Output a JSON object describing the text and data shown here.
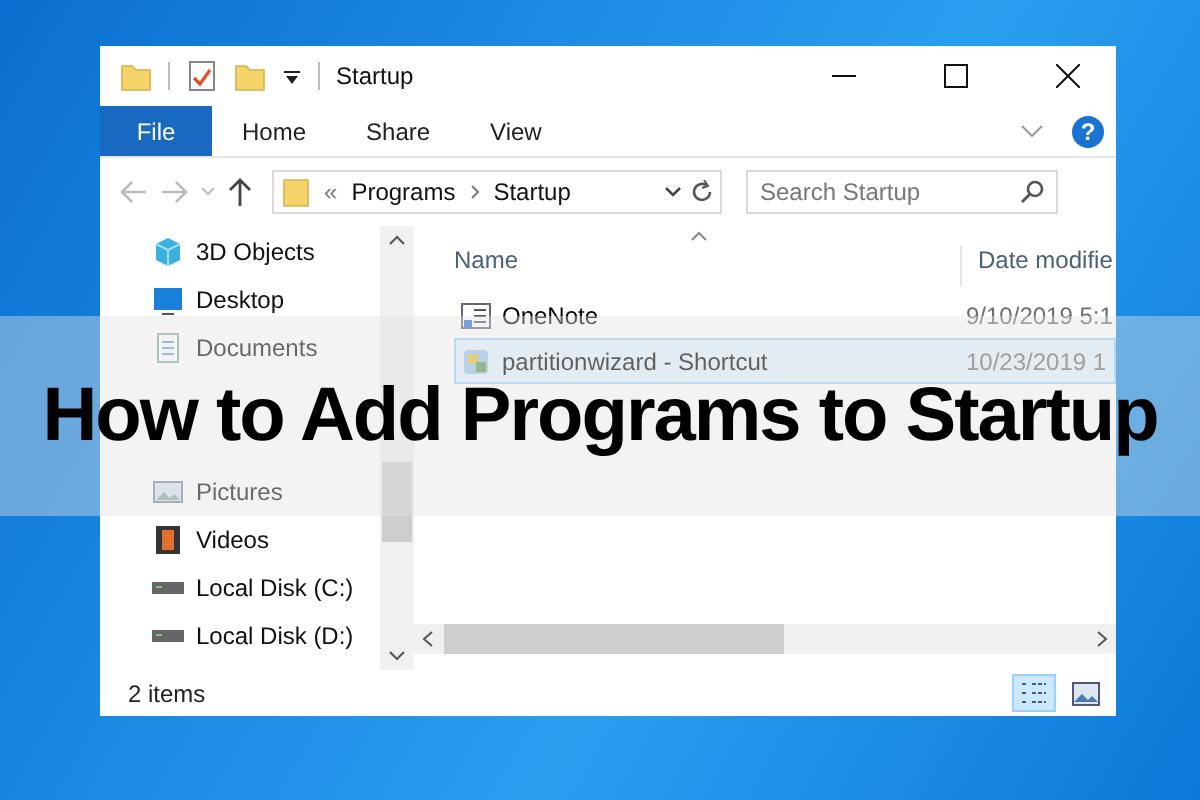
{
  "window": {
    "title": "Startup"
  },
  "ribbon": {
    "file_tab": "File",
    "tabs": [
      "Home",
      "Share",
      "View"
    ],
    "help": "?"
  },
  "address": {
    "overflow": "«",
    "path": [
      "Programs",
      "Startup"
    ]
  },
  "search": {
    "placeholder": "Search Startup"
  },
  "nav": [
    {
      "label": "3D Objects",
      "kind": "objects"
    },
    {
      "label": "Desktop",
      "kind": "desktop"
    },
    {
      "label": "Documents",
      "kind": "documents"
    },
    {
      "kind": "spacer"
    },
    {
      "kind": "spacer"
    },
    {
      "label": "Pictures",
      "kind": "pictures"
    },
    {
      "label": "Videos",
      "kind": "videos"
    },
    {
      "label": "Local Disk (C:)",
      "kind": "drive"
    },
    {
      "label": "Local Disk (D:)",
      "kind": "drive"
    }
  ],
  "columns": [
    "Name",
    "Date modifie"
  ],
  "files": [
    {
      "name": "OneNote",
      "date": "9/10/2019 5:1",
      "kind": "list",
      "selected": false
    },
    {
      "name": "partitionwizard - Shortcut",
      "date": "10/23/2019 1",
      "kind": "app",
      "selected": true
    }
  ],
  "status_bar": "2 items",
  "banner": "How to Add Programs to Startup"
}
